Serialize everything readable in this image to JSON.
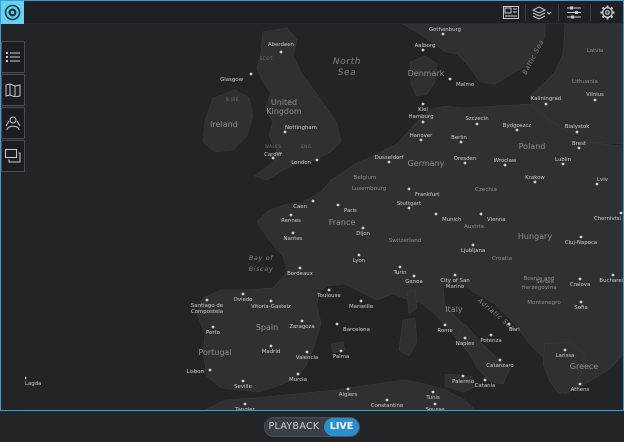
{
  "colors": {
    "accent": "#3a9fd8",
    "logo_bg": "#64d2f0",
    "live_bg": "#2a8fd0",
    "map_bg": "#232425",
    "land": "#2f3031",
    "water": "#232425",
    "city_dot": "#d0d0d0",
    "label": "#cfcfcf",
    "region_label": "#8f8f8f"
  },
  "toolbar": {
    "logo_icon": "target-icon",
    "icons": [
      "map-panel-icon",
      "layers-icon",
      "filter-sliders-icon",
      "gear-icon"
    ]
  },
  "sidebar": {
    "icons": [
      "list-icon",
      "map-book-icon",
      "people-icon",
      "chat-icon"
    ]
  },
  "bottom": {
    "playback_label": "PLAYBACK",
    "live_label": "LIVE"
  },
  "map": {
    "seas": [
      {
        "name": "North\nSea"
      },
      {
        "name": "Baltic Sea"
      },
      {
        "name": "Bay of\nBiscay"
      },
      {
        "name": "Adriatic Sea"
      }
    ],
    "countries": [
      {
        "name": "United\nKingdom"
      },
      {
        "name": "Ireland"
      },
      {
        "name": "Denmark"
      },
      {
        "name": "Germany"
      },
      {
        "name": "Poland"
      },
      {
        "name": "Czechia"
      },
      {
        "name": "France"
      },
      {
        "name": "Switzerland"
      },
      {
        "name": "Austria"
      },
      {
        "name": "Hungary"
      },
      {
        "name": "Italy"
      },
      {
        "name": "Spain"
      },
      {
        "name": "Portugal"
      },
      {
        "name": "Croatia"
      },
      {
        "name": "Serbia"
      },
      {
        "name": "Greece"
      },
      {
        "name": "Lithuania"
      },
      {
        "name": "Latvia"
      },
      {
        "name": "Belgium"
      },
      {
        "name": "Luxembourg"
      },
      {
        "name": "Montenegro"
      },
      {
        "name": "Bosnia and\nHerzegovina"
      }
    ],
    "regions": [
      {
        "name": "SCOT."
      },
      {
        "name": "N.IRE."
      },
      {
        "name": "WALES"
      },
      {
        "name": "ENG."
      }
    ],
    "cities": [
      "Aberdeen",
      "Glasgow",
      "Nottingham",
      "Cardiff",
      "London",
      "Gothenburg",
      "Aalborg",
      "Malmo",
      "Kiel",
      "Hamburg",
      "Hanover",
      "Berlin",
      "Szczecin",
      "Bydgoszcz",
      "Kaliningrad",
      "Vilnius",
      "Bialystok",
      "Brest",
      "Lublin",
      "Lviv",
      "Dusseldorf",
      "Dresden",
      "Wroclaw",
      "Krakow",
      "Frankfurt",
      "Stuttgart",
      "Munich",
      "Vienna",
      "Paris",
      "Caen",
      "Rennes",
      "Nantes",
      "Dijon",
      "Lyon",
      "Turin",
      "Genoa",
      "Bordeaux",
      "Toulouse",
      "Marseille",
      "Ljubljana",
      "Oviedo",
      "Santiago de\nCompostela",
      "Vitoria-Gasteiz",
      "Zaragoza",
      "Barcelona",
      "Porto",
      "Madrid",
      "Valencia",
      "Palma",
      "Lisbon",
      "Seville",
      "Murcia",
      "Algiers",
      "Tangier",
      "Tunis",
      "Constantine",
      "Sousse",
      "Rome",
      "Naples",
      "Palermo",
      "Catania",
      "Catanzaro",
      "Potenza",
      "Bari",
      "Larissa",
      "Athens",
      "Sofia",
      "Bucharest",
      "Craiova",
      "Cluj-Napoca",
      "Chernivtsi",
      "City of San\nMarino",
      "Lagda"
    ]
  }
}
